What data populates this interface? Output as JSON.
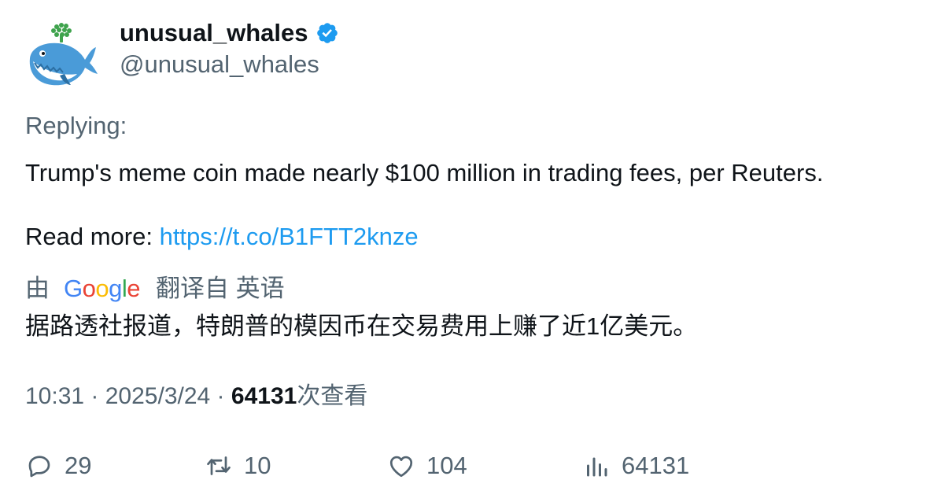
{
  "user": {
    "display_name": "unusual_whales",
    "handle": "@unusual_whales",
    "avatar_icon": "whale-logo-icon",
    "verified_icon": "verified-badge-icon"
  },
  "tweet": {
    "replying_label": "Replying:",
    "text_line_1": "Trump's meme coin made nearly $100 million in trading fees, per Reuters.",
    "read_more_label": "Read more: ",
    "link_text": "https://t.co/B1FTT2knze",
    "link_color": "#1d9bf0"
  },
  "translation": {
    "prefix": "由",
    "provider": "Google",
    "suffix": "翻译自 英语",
    "text": "据路透社报道，特朗普的模因币在交易费用上赚了近1亿美元。"
  },
  "meta": {
    "time": "10:31",
    "separator": " · ",
    "date": "2025/3/24",
    "views_count": "64131",
    "views_label": "次查看"
  },
  "actions": {
    "replies": "29",
    "retweets": "10",
    "likes": "104",
    "views": "64131"
  }
}
